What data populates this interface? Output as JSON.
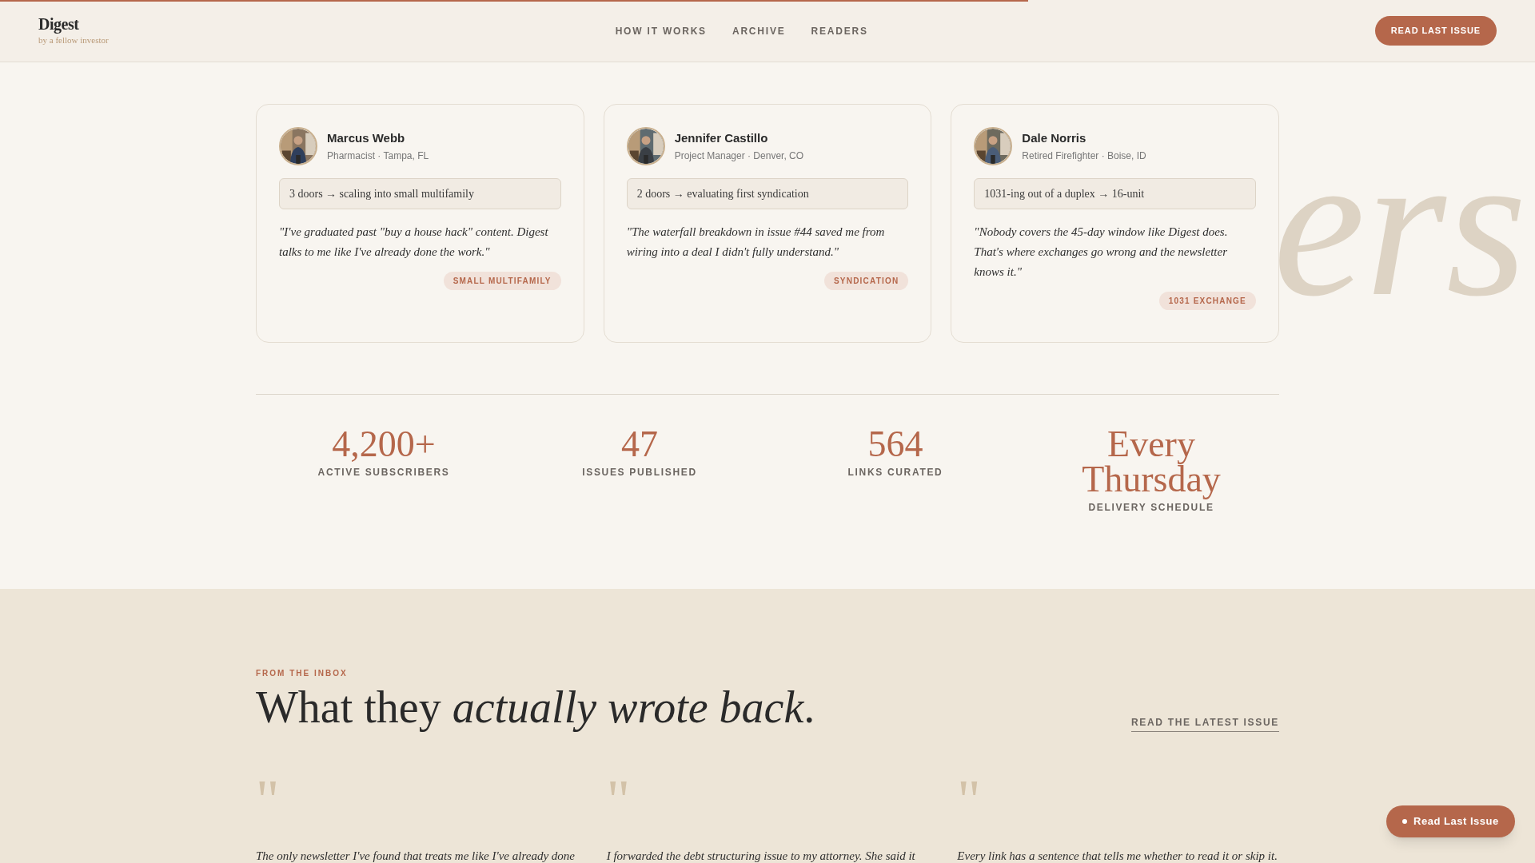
{
  "progress": {
    "level": 0.67
  },
  "brand": {
    "name": "Digest",
    "tagline": "by a fellow investor"
  },
  "nav": [
    "HOW IT WORKS",
    "ARCHIVE",
    "READERS"
  ],
  "cta": "READ LAST ISSUE",
  "backdrop_word": "ers",
  "readers": [
    {
      "name": "Marcus Webb",
      "role": "Pharmacist · Tampa, FL",
      "journey": "3 doors → scaling into small multifamily",
      "quote": "\"I've graduated past \"buy a house hack\" content. Digest talks to me like I've already done the work.\"",
      "tag": "SMALL MULTIFAMILY"
    },
    {
      "name": "Jennifer Castillo",
      "role": "Project Manager · Denver, CO",
      "journey": "2 doors → evaluating first syndication",
      "quote": "\"The waterfall breakdown in issue #44 saved me from wiring into a deal I didn't fully understand.\"",
      "tag": "SYNDICATION"
    },
    {
      "name": "Dale Norris",
      "role": "Retired Firefighter · Boise, ID",
      "journey": "1031-ing out of a duplex → 16-unit",
      "quote": "\"Nobody covers the 45-day window like Digest does. That's where exchanges go wrong and the newsletter knows it.\"",
      "tag": "1031 EXCHANGE"
    }
  ],
  "stats": [
    {
      "value": "4,200+",
      "label": "ACTIVE SUBSCRIBERS"
    },
    {
      "value": "47",
      "label": "ISSUES PUBLISHED"
    },
    {
      "value": "564",
      "label": "LINKS CURATED"
    },
    {
      "value": "Every Thursday",
      "label": "DELIVERY SCHEDULE"
    }
  ],
  "inbox": {
    "eyebrow": "FROM THE INBOX",
    "heading": "What they *actually wrote back*.",
    "link": "READ THE LATEST ISSUE",
    "letters": [
      {
        "mark": "\"",
        "text": "The only newsletter I've found that treats me like I've already done"
      },
      {
        "mark": "\"",
        "text": "I forwarded the debt structuring issue to my attorney. She said it"
      },
      {
        "mark": "\"",
        "text": "Every link has a sentence that tells me whether to read it or skip it."
      }
    ]
  },
  "floating_button": "Read Last Issue"
}
